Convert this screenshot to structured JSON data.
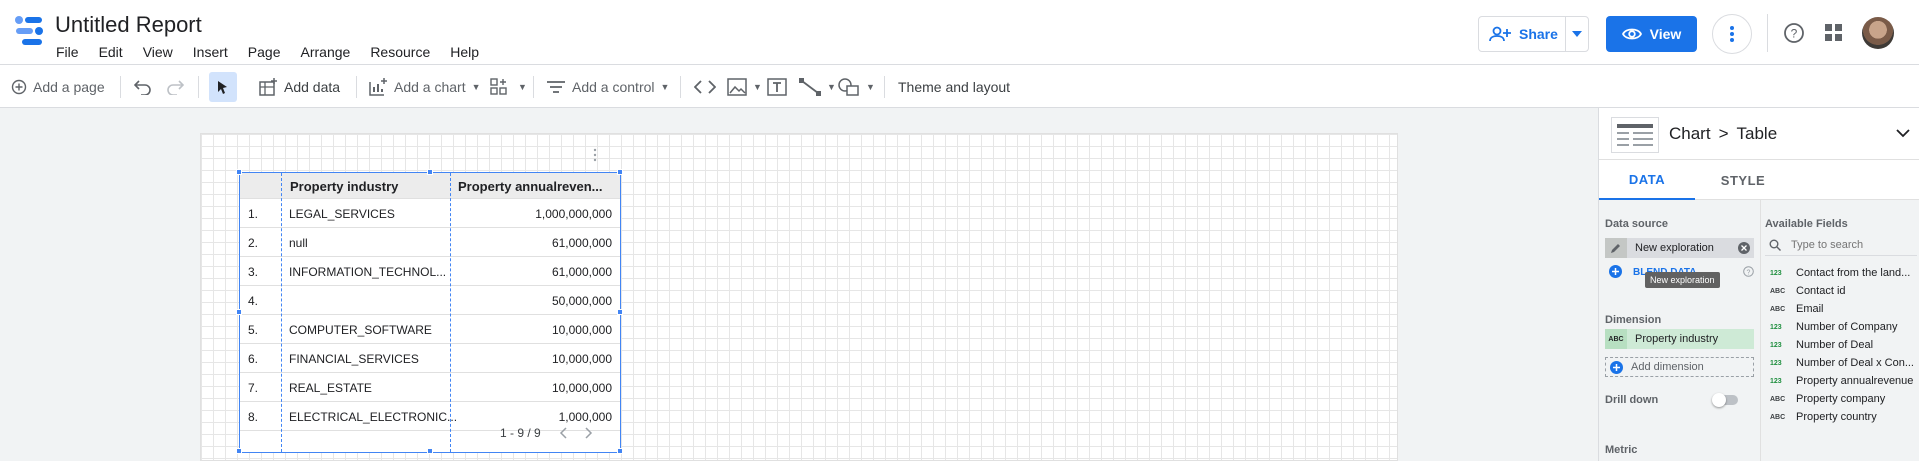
{
  "header": {
    "title": "Untitled Report",
    "menu": [
      "File",
      "Edit",
      "View",
      "Insert",
      "Page",
      "Arrange",
      "Resource",
      "Help"
    ],
    "share_label": "Share",
    "view_label": "View"
  },
  "toolbar": {
    "add_page": "Add a page",
    "add_data": "Add data",
    "add_chart": "Add a chart",
    "add_control": "Add a control",
    "theme": "Theme and layout"
  },
  "table": {
    "columns": [
      "Property industry",
      "Property annualreven..."
    ],
    "rows": [
      {
        "n": "1.",
        "industry": "LEGAL_SERVICES",
        "revenue": "1,000,000,000"
      },
      {
        "n": "2.",
        "industry": "null",
        "revenue": "61,000,000"
      },
      {
        "n": "3.",
        "industry": "INFORMATION_TECHNOL...",
        "revenue": "61,000,000"
      },
      {
        "n": "4.",
        "industry": "",
        "revenue": "50,000,000"
      },
      {
        "n": "5.",
        "industry": "COMPUTER_SOFTWARE",
        "revenue": "10,000,000"
      },
      {
        "n": "6.",
        "industry": "FINANCIAL_SERVICES",
        "revenue": "10,000,000"
      },
      {
        "n": "7.",
        "industry": "REAL_ESTATE",
        "revenue": "10,000,000"
      },
      {
        "n": "8.",
        "industry": "ELECTRICAL_ELECTRONIC...",
        "revenue": "1,000,000"
      }
    ],
    "pagination": "1 - 9 / 9"
  },
  "panel": {
    "breadcrumb_chart": "Chart",
    "breadcrumb_sep": ">",
    "breadcrumb_table": "Table",
    "tab_data": "DATA",
    "tab_style": "STYLE",
    "data_source_title": "Data source",
    "data_source_name": "New exploration",
    "blend_data": "BLEND DATA",
    "tooltip": "New exploration",
    "dimension_title": "Dimension",
    "dimension_field": "Property industry",
    "add_dimension": "Add dimension",
    "drill_down": "Drill down",
    "metric_title": "Metric",
    "available_fields_title": "Available Fields",
    "search_placeholder": "Type to search",
    "fields": [
      {
        "type": "123",
        "name": "Contact from the land..."
      },
      {
        "type": "ABC",
        "name": "Contact id"
      },
      {
        "type": "ABC",
        "name": "Email"
      },
      {
        "type": "123",
        "name": "Number of Company"
      },
      {
        "type": "123",
        "name": "Number of Deal"
      },
      {
        "type": "123",
        "name": "Number of Deal x Con..."
      },
      {
        "type": "123",
        "name": "Property annualrevenue"
      },
      {
        "type": "ABC",
        "name": "Property company"
      },
      {
        "type": "ABC",
        "name": "Property country"
      }
    ]
  },
  "colors": {
    "accent": "#1a73e8",
    "dimension_bg": "#ceead6",
    "selection": "#4285f4"
  }
}
